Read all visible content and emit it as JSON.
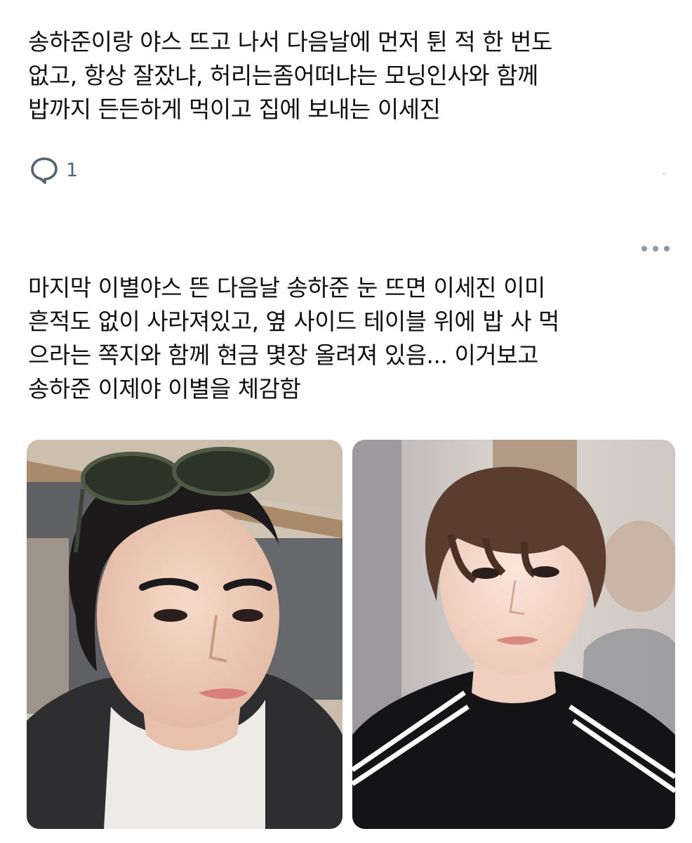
{
  "post1": {
    "text": "송하준이랑 야스 뜨고 나서 다음날에 먼저 튄 적 한 번도\n없고,   항상 잘잤냐, 허리는좀어떠냐는 모닝인사와 함께\n밥까지 든든하게 먹이고 집에 보내는 이세진",
    "reply_count": "1",
    "reply_icon": "speech-bubble-icon"
  },
  "post2": {
    "more_icon": "more-options-icon",
    "text": "마지막 이별야스 뜬 다음날 송하준 눈 뜨면 이세진 이미\n흔적도 없이 사라져있고,  옆 사이드 테이블 위에 밥 사 먹\n으라는 쪽지와 함께 현금 몇장 올려져 있음... 이거보고\n송하준 이제야 이별을 체감함",
    "photos": [
      {
        "name": "selfie-photo"
      },
      {
        "name": "portrait-photo"
      }
    ]
  },
  "colors": {
    "text": "#111111",
    "icon_gray": "#536471",
    "dots_gray": "#8b98a5"
  }
}
